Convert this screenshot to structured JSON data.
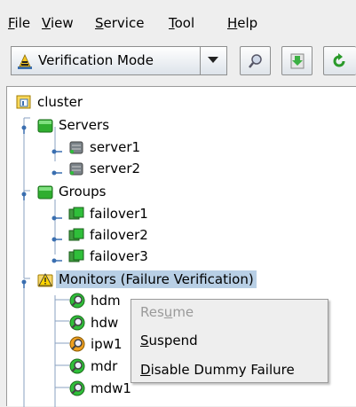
{
  "menubar": {
    "items": [
      {
        "mnemonic": "F",
        "rest": "ile"
      },
      {
        "mnemonic": "V",
        "rest": "iew"
      },
      {
        "mnemonic": "S",
        "rest": "ervice"
      },
      {
        "mnemonic": "T",
        "rest": "ool"
      },
      {
        "mnemonic": "H",
        "rest": "elp"
      }
    ]
  },
  "toolbar": {
    "mode_select": {
      "value": "Verification Mode"
    },
    "buttons": [
      {
        "icon": "search-icon"
      },
      {
        "icon": "download-icon"
      },
      {
        "icon": "refresh-icon"
      }
    ]
  },
  "tree": {
    "root": {
      "label": "cluster",
      "icon": "cluster-icon"
    },
    "servers": {
      "label": "Servers",
      "icon": "green-folder-icon",
      "items": [
        "server1",
        "server2"
      ]
    },
    "groups": {
      "label": "Groups",
      "icon": "green-folder-icon",
      "items": [
        "failover1",
        "failover2",
        "failover3"
      ]
    },
    "monitors": {
      "label": "Monitors (Failure Verification)",
      "icon": "warning-folder-icon",
      "items": [
        "hdm",
        "hdw",
        "ipw1",
        "mdr",
        "mdw1"
      ]
    }
  },
  "context_menu": {
    "items": [
      {
        "pre": "Res",
        "mnemonic": "u",
        "post": "me",
        "enabled": false
      },
      {
        "pre": "",
        "mnemonic": "S",
        "post": "uspend",
        "enabled": true
      },
      {
        "pre": "",
        "mnemonic": "D",
        "post": "isable Dummy Failure",
        "enabled": true
      }
    ]
  },
  "colors": {
    "selection": "#b8cfe5",
    "group_green": "#2fae2f",
    "monitor_ok": "#2fbf3a",
    "monitor_warn": "#f0a020"
  }
}
